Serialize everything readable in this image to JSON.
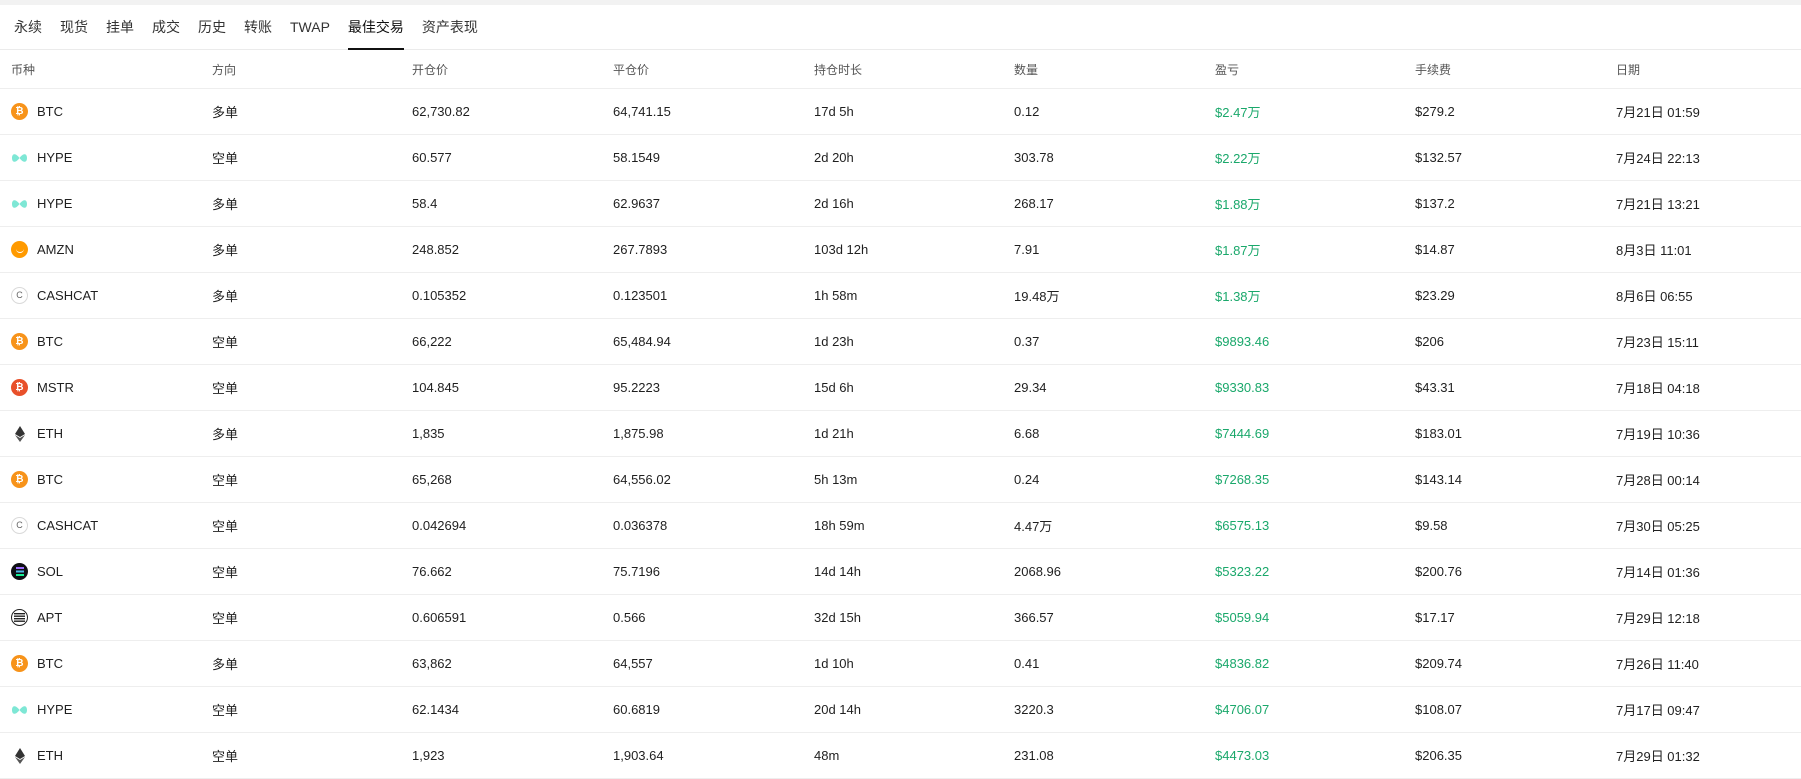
{
  "tabs": [
    {
      "label": "永续"
    },
    {
      "label": "现货"
    },
    {
      "label": "挂单"
    },
    {
      "label": "成交"
    },
    {
      "label": "历史"
    },
    {
      "label": "转账"
    },
    {
      "label": "TWAP"
    },
    {
      "label": "最佳交易",
      "active": true
    },
    {
      "label": "资产表现"
    }
  ],
  "columns": [
    "币种",
    "方向",
    "开仓价",
    "平仓价",
    "持仓时长",
    "数量",
    "盈亏",
    "手续费",
    "日期"
  ],
  "rows": [
    {
      "coin": "BTC",
      "icon": "bitcoin-icon",
      "side": "多单",
      "open": "62,730.82",
      "close": "64,741.15",
      "duration": "17d 5h",
      "qty": "0.12",
      "pnl": "$2.47万",
      "fee": "$279.2",
      "date": "7月21日 01:59"
    },
    {
      "coin": "HYPE",
      "icon": "hyperliquid-icon",
      "side": "空单",
      "open": "60.577",
      "close": "58.1549",
      "duration": "2d 20h",
      "qty": "303.78",
      "pnl": "$2.22万",
      "fee": "$132.57",
      "date": "7月24日 22:13"
    },
    {
      "coin": "HYPE",
      "icon": "hyperliquid-icon",
      "side": "多单",
      "open": "58.4",
      "close": "62.9637",
      "duration": "2d 16h",
      "qty": "268.17",
      "pnl": "$1.88万",
      "fee": "$137.2",
      "date": "7月21日 13:21"
    },
    {
      "coin": "AMZN",
      "icon": "amazon-icon",
      "side": "多单",
      "open": "248.852",
      "close": "267.7893",
      "duration": "103d 12h",
      "qty": "7.91",
      "pnl": "$1.87万",
      "fee": "$14.87",
      "date": "8月3日 11:01"
    },
    {
      "coin": "CASHCAT",
      "icon": "cashcat-icon",
      "side": "多单",
      "open": "0.105352",
      "close": "0.123501",
      "duration": "1h 58m",
      "qty": "19.48万",
      "pnl": "$1.38万",
      "fee": "$23.29",
      "date": "8月6日 06:55"
    },
    {
      "coin": "BTC",
      "icon": "bitcoin-icon",
      "side": "空单",
      "open": "66,222",
      "close": "65,484.94",
      "duration": "1d 23h",
      "qty": "0.37",
      "pnl": "$9893.46",
      "fee": "$206",
      "date": "7月23日 15:11"
    },
    {
      "coin": "MSTR",
      "icon": "mstr-icon",
      "side": "空单",
      "open": "104.845",
      "close": "95.2223",
      "duration": "15d 6h",
      "qty": "29.34",
      "pnl": "$9330.83",
      "fee": "$43.31",
      "date": "7月18日 04:18"
    },
    {
      "coin": "ETH",
      "icon": "ethereum-icon",
      "side": "多单",
      "open": "1,835",
      "close": "1,875.98",
      "duration": "1d 21h",
      "qty": "6.68",
      "pnl": "$7444.69",
      "fee": "$183.01",
      "date": "7月19日 10:36"
    },
    {
      "coin": "BTC",
      "icon": "bitcoin-icon",
      "side": "空单",
      "open": "65,268",
      "close": "64,556.02",
      "duration": "5h 13m",
      "qty": "0.24",
      "pnl": "$7268.35",
      "fee": "$143.14",
      "date": "7月28日 00:14"
    },
    {
      "coin": "CASHCAT",
      "icon": "cashcat-icon",
      "side": "空单",
      "open": "0.042694",
      "close": "0.036378",
      "duration": "18h 59m",
      "qty": "4.47万",
      "pnl": "$6575.13",
      "fee": "$9.58",
      "date": "7月30日 05:25"
    },
    {
      "coin": "SOL",
      "icon": "solana-icon",
      "side": "空单",
      "open": "76.662",
      "close": "75.7196",
      "duration": "14d 14h",
      "qty": "2068.96",
      "pnl": "$5323.22",
      "fee": "$200.76",
      "date": "7月14日 01:36"
    },
    {
      "coin": "APT",
      "icon": "aptos-icon",
      "side": "空单",
      "open": "0.606591",
      "close": "0.566",
      "duration": "32d 15h",
      "qty": "366.57",
      "pnl": "$5059.94",
      "fee": "$17.17",
      "date": "7月29日 12:18"
    },
    {
      "coin": "BTC",
      "icon": "bitcoin-icon",
      "side": "多单",
      "open": "63,862",
      "close": "64,557",
      "duration": "1d 10h",
      "qty": "0.41",
      "pnl": "$4836.82",
      "fee": "$209.74",
      "date": "7月26日 11:40"
    },
    {
      "coin": "HYPE",
      "icon": "hyperliquid-icon",
      "side": "空单",
      "open": "62.1434",
      "close": "60.6819",
      "duration": "20d 14h",
      "qty": "3220.3",
      "pnl": "$4706.07",
      "fee": "$108.07",
      "date": "7月17日 09:47"
    },
    {
      "coin": "ETH",
      "icon": "ethereum-icon",
      "side": "空单",
      "open": "1,923",
      "close": "1,903.64",
      "duration": "48m",
      "qty": "231.08",
      "pnl": "$4473.03",
      "fee": "$206.35",
      "date": "7月29日 01:32"
    }
  ],
  "colors": {
    "pnl_positive": "#1aa86b",
    "btc": "#f7931a",
    "hype": "#7ee7d5",
    "amzn": "#ff9a00",
    "mstr": "#e8502a",
    "eth": "#222222"
  }
}
